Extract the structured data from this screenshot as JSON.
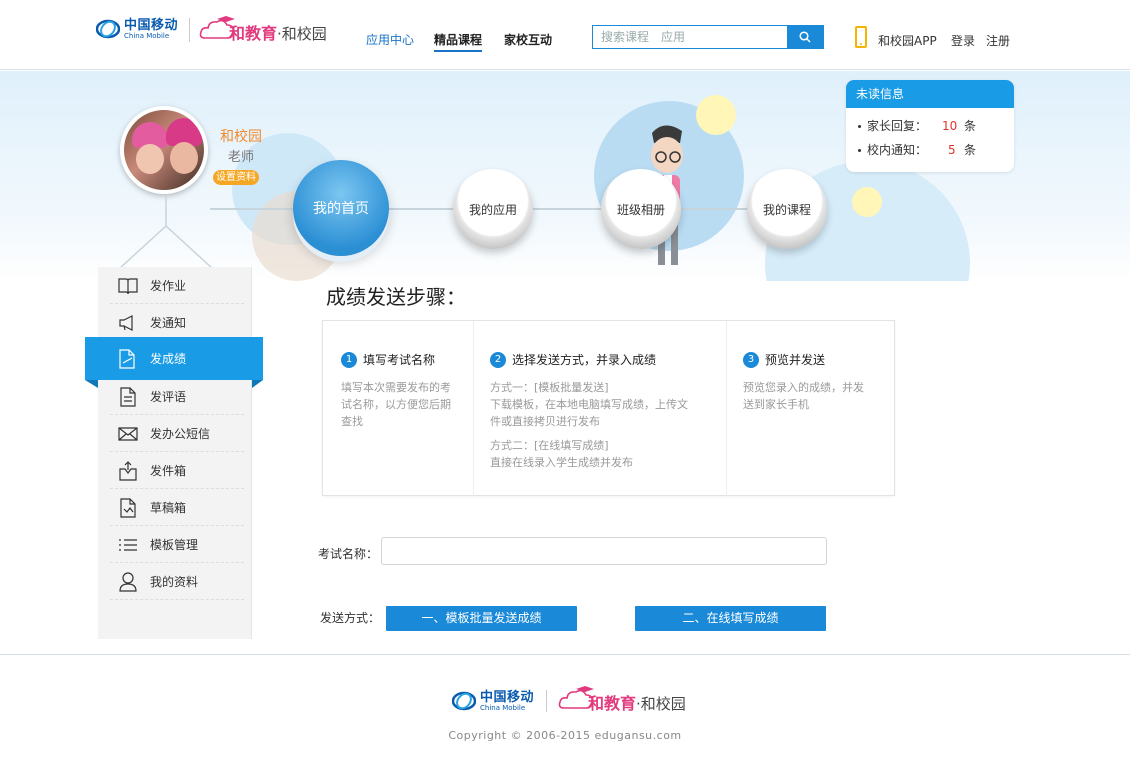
{
  "header": {
    "cm_logo_cn": "中国移动",
    "cm_logo_en": "China Mobile",
    "hjy_logo_brand": "和教育",
    "hjy_logo_sep": "·",
    "hjy_logo_school": "和校园",
    "nav": [
      {
        "label": "应用中心"
      },
      {
        "label": "精品课程"
      },
      {
        "label": "家校互动"
      }
    ],
    "search_placeholder": "搜索课程　应用",
    "app_link": "和校园APP",
    "login": "登录",
    "register": "注册"
  },
  "profile": {
    "name": "和校园",
    "role": "老师",
    "settings_label": "设置资料"
  },
  "main_nav": [
    {
      "label": "我的首页"
    },
    {
      "label": "我的应用"
    },
    {
      "label": "班级相册"
    },
    {
      "label": "我的课程"
    }
  ],
  "unread": {
    "title": "未读信息",
    "items": [
      {
        "label": "家长回复：",
        "count": "10",
        "unit": "条"
      },
      {
        "label": "校内通知：",
        "count": "5",
        "unit": "条"
      }
    ]
  },
  "sidebar": {
    "items": [
      {
        "label": "发作业",
        "icon": "book-icon"
      },
      {
        "label": "发通知",
        "icon": "megaphone-icon"
      },
      {
        "label": "发成绩",
        "icon": "edit-document-icon"
      },
      {
        "label": "发评语",
        "icon": "document-icon"
      },
      {
        "label": "发办公短信",
        "icon": "envelope-icon"
      },
      {
        "label": "发件箱",
        "icon": "outbox-icon"
      },
      {
        "label": "草稿箱",
        "icon": "draft-icon"
      },
      {
        "label": "模板管理",
        "icon": "list-icon"
      },
      {
        "label": "我的资料",
        "icon": "user-icon"
      }
    ],
    "active_index": 2
  },
  "content": {
    "steps_title": "成绩发送步骤：",
    "steps": [
      {
        "num": "1",
        "title": "填写考试名称",
        "desc": [
          "填写本次需要发布的考",
          "试名称，以方便您后期",
          "查找"
        ]
      },
      {
        "num": "2",
        "title": "选择发送方式，并录入成绩",
        "desc": [
          "方式一：[模板批量发送]",
          "下载模板，在本地电脑填写成绩，上传文",
          "件或直接拷贝进行发布"
        ],
        "desc2": [
          "方式二：[在线填写成绩]",
          "直接在线录入学生成绩并发布"
        ]
      },
      {
        "num": "3",
        "title": "预览并发送",
        "desc": [
          "预览您录入的成绩，并发",
          "送到家长手机"
        ]
      }
    ],
    "exam_label": "考试名称：",
    "exam_value": "",
    "send_label": "发送方式：",
    "send_buttons": [
      "一、模板批量发送成绩",
      "二、在线填写成绩"
    ]
  },
  "footer": {
    "copyright": "Copyright © 2006-2015  edugansu.com"
  },
  "colors": {
    "primary_blue": "#1a8ad8",
    "accent_pink": "#e23a7e",
    "accent_orange": "#f5a623",
    "alert_red": "#e3342f"
  }
}
